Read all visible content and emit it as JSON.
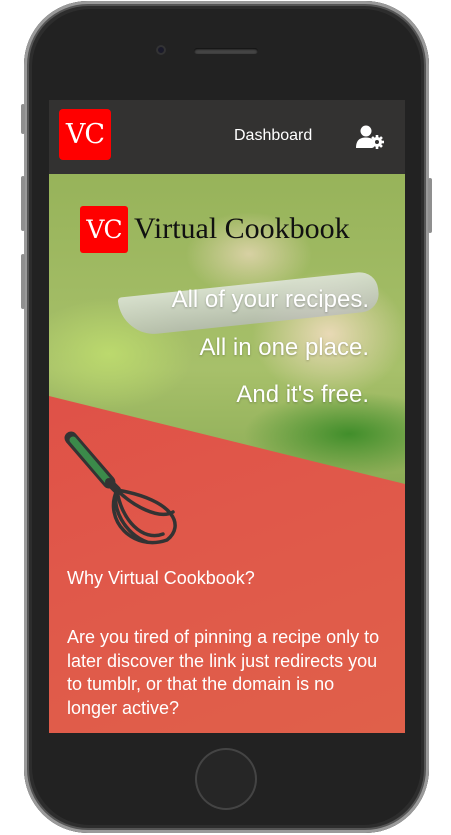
{
  "navbar": {
    "logo_text": "VC",
    "dashboard_label": "Dashboard",
    "user_icon": "user-gear-icon"
  },
  "hero": {
    "brand_logo_text": "VC",
    "brand_name": "Virtual Cookbook",
    "tagline_lines": [
      "All of your recipes.",
      "All in one place.",
      "And it's free."
    ]
  },
  "feature": {
    "icon": "whisk-icon",
    "title": "Why Virtual Cookbook?",
    "body": "Are you tired of pinning a recipe only to later discover the link just redirects you to tumblr, or that the domain is no longer active?"
  },
  "colors": {
    "nav_bg": "#333231",
    "logo_red": "#ff0000",
    "panel_red": "#de4a44",
    "whisk_handle": "#3b8a4a"
  }
}
